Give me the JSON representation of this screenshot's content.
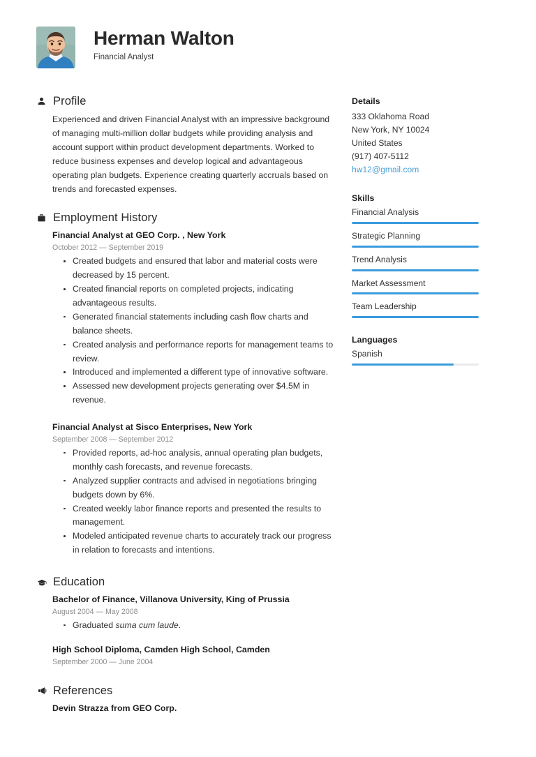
{
  "header": {
    "name": "Herman Walton",
    "job_title": "Financial Analyst",
    "photo_alt": "profile-photo"
  },
  "theme": {
    "accent": "#3a9bdc",
    "link": "#4a9fd5",
    "text": "#333333",
    "muted": "#8c8c8c",
    "track": "#e9eaec"
  },
  "sections": {
    "profile": {
      "icon": "person-icon",
      "title": "Profile",
      "text": "Experienced and driven Financial Analyst with an impressive background of managing multi-million dollar budgets while providing analysis and account support within product development departments. Worked to reduce business expenses and develop logical and advantageous operating plan budgets. Experience creating quarterly accruals based on trends and forecasted expenses."
    },
    "employment": {
      "icon": "briefcase-icon",
      "title": "Employment History",
      "entries": [
        {
          "title": "Financial Analyst at GEO Corp. , New York",
          "date": "October 2012 — September 2019",
          "bullets": [
            "Created budgets and ensured that labor and material costs were decreased by 15 percent.",
            "Created financial reports on completed projects, indicating advantageous results.",
            "Generated financial statements including cash flow charts and balance sheets.",
            "Created analysis and performance reports for management teams to review.",
            "Introduced and implemented a different type of innovative software.",
            "Assessed new development projects generating over $4.5M in revenue."
          ]
        },
        {
          "title": "Financial Analyst at Sisco Enterprises, New York",
          "date": "September 2008 — September 2012",
          "bullets": [
            "Provided reports, ad-hoc analysis, annual operating plan budgets, monthly cash forecasts, and revenue forecasts.",
            "Analyzed supplier contracts and advised in negotiations bringing budgets down by 6%.",
            "Created weekly labor finance reports and presented the results to management.",
            "Modeled anticipated revenue charts to accurately track our progress in relation to forecasts and intentions."
          ]
        }
      ]
    },
    "education": {
      "icon": "graduation-cap-icon",
      "title": "Education",
      "entries": [
        {
          "title": "Bachelor of Finance, Villanova University, King of Prussia",
          "date": "August 2004 — May 2008",
          "bullet_prefix": "Graduated ",
          "bullet_italic": "suma cum laude",
          "bullet_suffix": "."
        },
        {
          "title": "High School Diploma, Camden High School, Camden",
          "date": "September 2000 — June 2004"
        }
      ]
    },
    "references": {
      "icon": "megaphone-icon",
      "title": "References",
      "entries": [
        {
          "title": "Devin Strazza from GEO Corp."
        }
      ]
    }
  },
  "sidebar": {
    "details": {
      "title": "Details",
      "address_line1": "333 Oklahoma Road",
      "address_line2": "New York, NY 10024",
      "country": "United States",
      "phone": "(917) 407-5112",
      "email": "hw12@gmail.com"
    },
    "skills": {
      "title": "Skills",
      "items": [
        {
          "label": "Financial Analysis",
          "level": 100
        },
        {
          "label": "Strategic Planning",
          "level": 100
        },
        {
          "label": "Trend Analysis",
          "level": 100
        },
        {
          "label": "Market Assessment",
          "level": 100
        },
        {
          "label": "Team Leadership",
          "level": 100
        }
      ]
    },
    "languages": {
      "title": "Languages",
      "items": [
        {
          "label": "Spanish",
          "level": 80
        }
      ]
    }
  }
}
